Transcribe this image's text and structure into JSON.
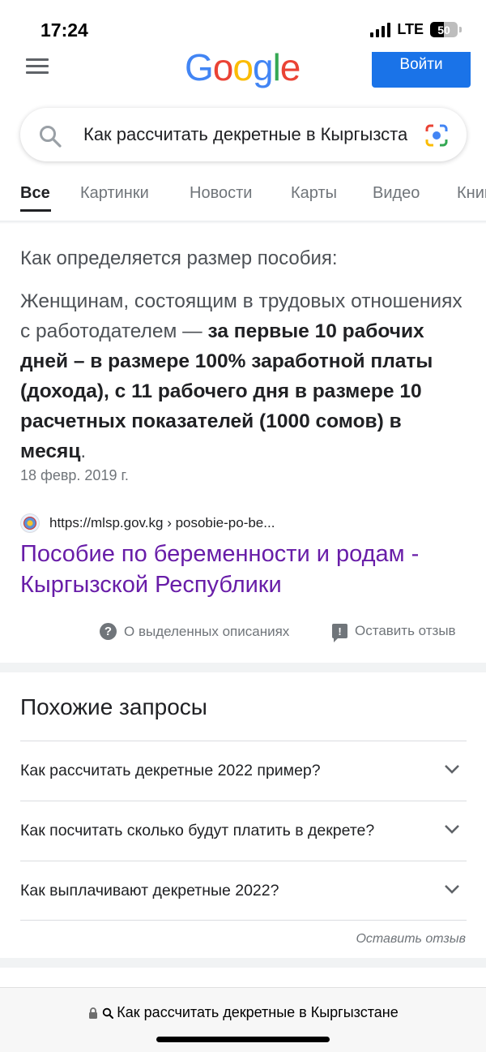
{
  "status_bar": {
    "time": "17:24",
    "network": "LTE",
    "battery": "50",
    "battery_level": 0.5
  },
  "header": {
    "logo_letters": [
      {
        "char": "G",
        "color": "#4285f4"
      },
      {
        "char": "o",
        "color": "#ea4335"
      },
      {
        "char": "o",
        "color": "#fbbc05"
      },
      {
        "char": "g",
        "color": "#4285f4"
      },
      {
        "char": "l",
        "color": "#34a853"
      },
      {
        "char": "e",
        "color": "#ea4335"
      }
    ],
    "signin_label": "Войти"
  },
  "search": {
    "query": "Как рассчитать декретные в Кыргызстане"
  },
  "tabs": [
    {
      "label": "Все",
      "active": true
    },
    {
      "label": "Картинки",
      "active": false
    },
    {
      "label": "Новости",
      "active": false
    },
    {
      "label": "Карты",
      "active": false
    },
    {
      "label": "Видео",
      "active": false
    },
    {
      "label": "Книги",
      "active": false
    }
  ],
  "snippet": {
    "heading": "Как определяется размер пособия:",
    "body_plain": "Женщинам, состоящим в трудовых отношениях с работодателем — ",
    "body_bold": "за первые 10 рабочих дней – в размере 100% заработной платы (дохода), с 11 рабочего дня в размере 10 расчетных показателей (1000 сомов) в месяц",
    "body_end": ".",
    "date": "18 февр. 2019 г.",
    "source_url": "https://mlsp.gov.kg › posobie-po-be...",
    "title": "Пособие по беременности и родам - Кыргызской Республики"
  },
  "snippet_footer": {
    "about_label": "О выделенных описаниях",
    "feedback_label": "Оставить отзыв"
  },
  "related": {
    "title": "Похожие запросы",
    "items": [
      "Как рассчитать декретные 2022 пример?",
      "Как посчитать сколько будут платить в декрете?",
      "Как выплачивают декретные 2022?"
    ],
    "feedback_label": "Оставить отзыв"
  },
  "browser": {
    "url_text": "Как рассчитать декретные в Кыргызстане"
  }
}
